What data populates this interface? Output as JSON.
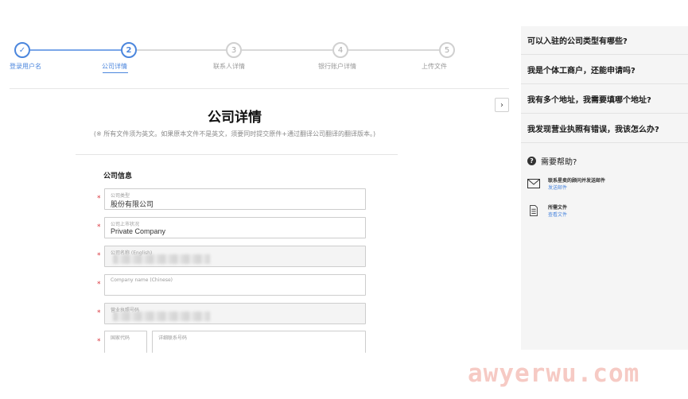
{
  "stepper": {
    "steps": [
      {
        "number": "✓",
        "label": "登录用户名",
        "state": "done"
      },
      {
        "number": "2",
        "label": "公司详情",
        "state": "active"
      },
      {
        "number": "3",
        "label": "联系人详情",
        "state": "pending"
      },
      {
        "number": "4",
        "label": "银行账户详情",
        "state": "pending"
      },
      {
        "number": "5",
        "label": "上传文件",
        "state": "pending"
      }
    ]
  },
  "main": {
    "title": "公司详情",
    "note": "(※ 所有文件须为英文。如果原本文件不是英文，须要同时提交原件+通过翻译公司翻译的翻译版本。)",
    "section_title": "公司信息",
    "fields": {
      "company_type": {
        "label": "公司类型",
        "value": "股份有限公司",
        "required": "*"
      },
      "listing_status": {
        "label": "公司上市状况",
        "value": "Private Company",
        "required": "*"
      },
      "company_name_en": {
        "label": "公司名称 (English)",
        "value": "",
        "required": "*"
      },
      "company_name_cn": {
        "label": "Company name (Chinese)",
        "value": "",
        "required": "*"
      },
      "business_license": {
        "label": "营业执照号码",
        "value": "",
        "required": "*"
      },
      "country_code": {
        "label": "国家代码",
        "value": "",
        "required": "*"
      },
      "phone": {
        "label": "详细联系号码",
        "value": "",
        "required": ""
      }
    }
  },
  "sidebar": {
    "faqs": [
      "可以入驻的公司类型有哪些?",
      "我是个体工商户，还能申请吗?",
      "我有多个地址，我需要填哪个地址?",
      "我发现营业执照有错误，我该怎么办?"
    ],
    "help_title": "需要帮助?",
    "help_icon": "?",
    "help_items": [
      {
        "text": "联系星卖的顾问并发送邮件",
        "link": "发送邮件",
        "icon": "envelope-icon"
      },
      {
        "text": "所需文件",
        "link": "查看文件",
        "icon": "document-icon"
      }
    ]
  },
  "collapse_glyph": "›",
  "watermark": "awyerwu.com",
  "colors": {
    "accent": "#4b86dd",
    "required": "#d9363e",
    "sidebar_bg": "#f5f5f5"
  }
}
